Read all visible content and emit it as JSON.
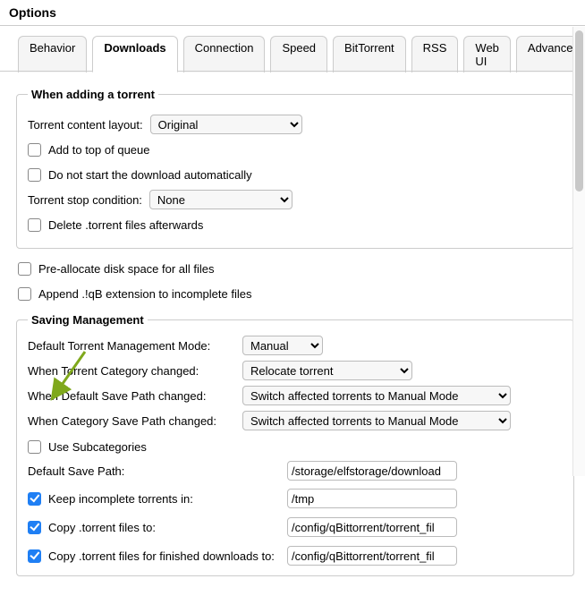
{
  "window": {
    "title": "Options"
  },
  "tabs": {
    "behavior": "Behavior",
    "downloads": "Downloads",
    "connection": "Connection",
    "speed": "Speed",
    "bittorrent": "BitTorrent",
    "rss": "RSS",
    "webui": "Web UI",
    "advanced": "Advanced"
  },
  "adding": {
    "legend": "When adding a torrent",
    "content_layout_label": "Torrent content layout:",
    "content_layout_value": "Original",
    "add_top": "Add to top of queue",
    "no_auto_start": "Do not start the download automatically",
    "stop_cond_label": "Torrent stop condition:",
    "stop_cond_value": "None",
    "delete_torrent": "Delete .torrent files afterwards"
  },
  "misc": {
    "prealloc": "Pre-allocate disk space for all files",
    "append_qb": "Append .!qB extension to incomplete files"
  },
  "saving": {
    "legend": "Saving Management",
    "mgmt_mode_label": "Default Torrent Management Mode:",
    "mgmt_mode_value": "Manual",
    "cat_changed_label": "When Torrent Category changed:",
    "cat_changed_value": "Relocate torrent",
    "default_path_changed_label": "When Default Save Path changed:",
    "default_path_changed_value": "Switch affected torrents to Manual Mode",
    "cat_path_changed_label": "When Category Save Path changed:",
    "cat_path_changed_value": "Switch affected torrents to Manual Mode",
    "use_subcats": "Use Subcategories",
    "default_save_label": "Default Save Path:",
    "default_save_value": "/storage/elfstorage/download",
    "keep_incomplete_label": "Keep incomplete torrents in:",
    "keep_incomplete_value": "/tmp",
    "copy_torrent_label": "Copy .torrent files to:",
    "copy_torrent_value": "/config/qBittorrent/torrent_fil",
    "copy_finished_label": "Copy .torrent files for finished downloads to:",
    "copy_finished_value": "/config/qBittorrent/torrent_fil"
  },
  "colors": {
    "accent": "#1f7ff4",
    "arrow": "#7fa81c"
  }
}
